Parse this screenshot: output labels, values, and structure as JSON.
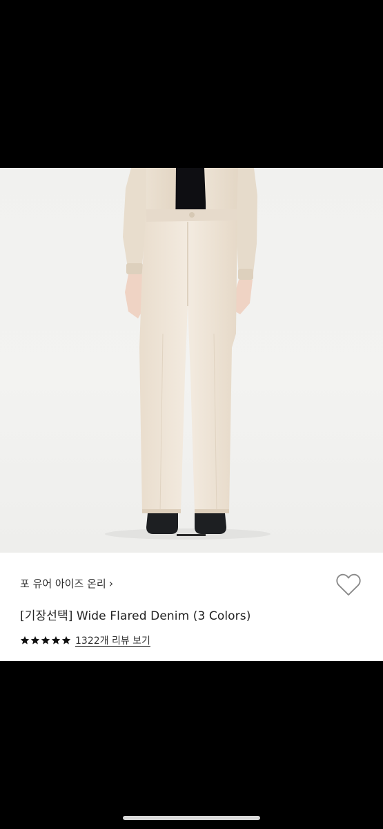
{
  "product": {
    "image_alt_name": "wide-flared-denim-photo",
    "brand": "포 유어 아이즈 온리",
    "title": "[기장선택] Wide Flared Denim (3 Colors)",
    "rating": 5,
    "rating_max": 5,
    "review_link": "1322개 리뷰 보기"
  },
  "icons": {
    "brand_chevron": "chevron-right-icon",
    "wishlist": "heart-outline-icon",
    "star": "star-filled-icon"
  },
  "colors": {
    "star": "#111111",
    "heart_stroke": "#8a8a8a",
    "denim": "#efe6da"
  }
}
